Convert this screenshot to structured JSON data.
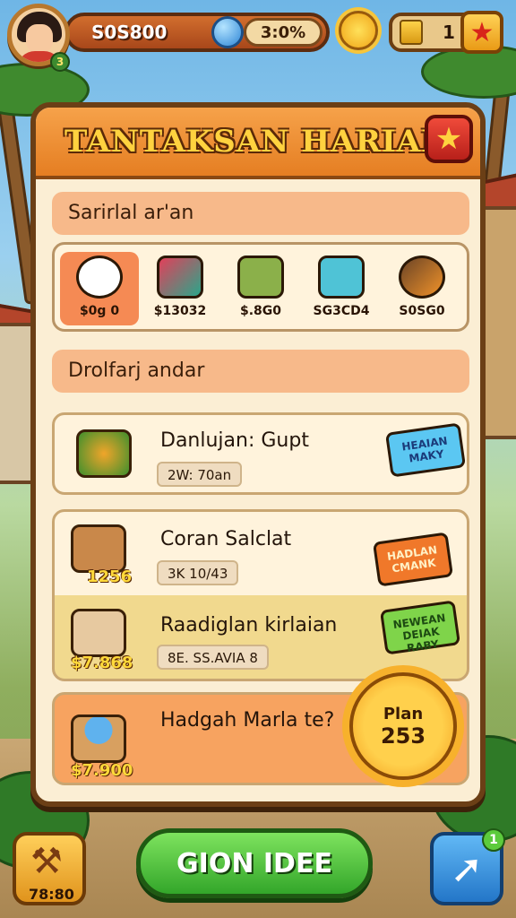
{
  "hud": {
    "coins": "S0S800",
    "percent": "3:0%",
    "tickets": "1",
    "avatar_badge": "3",
    "star_icon": "star-icon"
  },
  "panel": {
    "title": "TANTAKSAN HARIAN",
    "section1_label": "Sarirlal ar'an",
    "section2_label": "Drolfarj andar",
    "rewards": [
      {
        "value": "$0g 0",
        "icon": "plush-toy-icon",
        "active": true
      },
      {
        "value": "$13032",
        "icon": "tool-icon"
      },
      {
        "value": "$.8G0",
        "icon": "board-icon"
      },
      {
        "value": "SG3CD4",
        "icon": "chest-icon"
      },
      {
        "value": "S0SG0",
        "icon": "torch-icon"
      }
    ],
    "tasks": [
      {
        "title": "Danlujan: Gupt",
        "progress": "2W: 70an",
        "tag": "HEAIAN MAKY"
      },
      {
        "title": "Coran Salclat",
        "progress": "3K 10/43",
        "price": "1256",
        "tag": "HADLAN CMANK"
      },
      {
        "title": "Raadiglan kirlaian",
        "progress": "8E. SS.AVIA 8",
        "price": "$7.868",
        "tag": "NEWEAN DEIAK RABY"
      },
      {
        "title": "Hadgah Marla te?",
        "price": "$7.900"
      }
    ],
    "sun_badge": {
      "line1": "Plan",
      "line2": "253"
    }
  },
  "footer": {
    "hammer_value": "78:80",
    "go_label": "GION IDEE",
    "share_badge": "1"
  }
}
